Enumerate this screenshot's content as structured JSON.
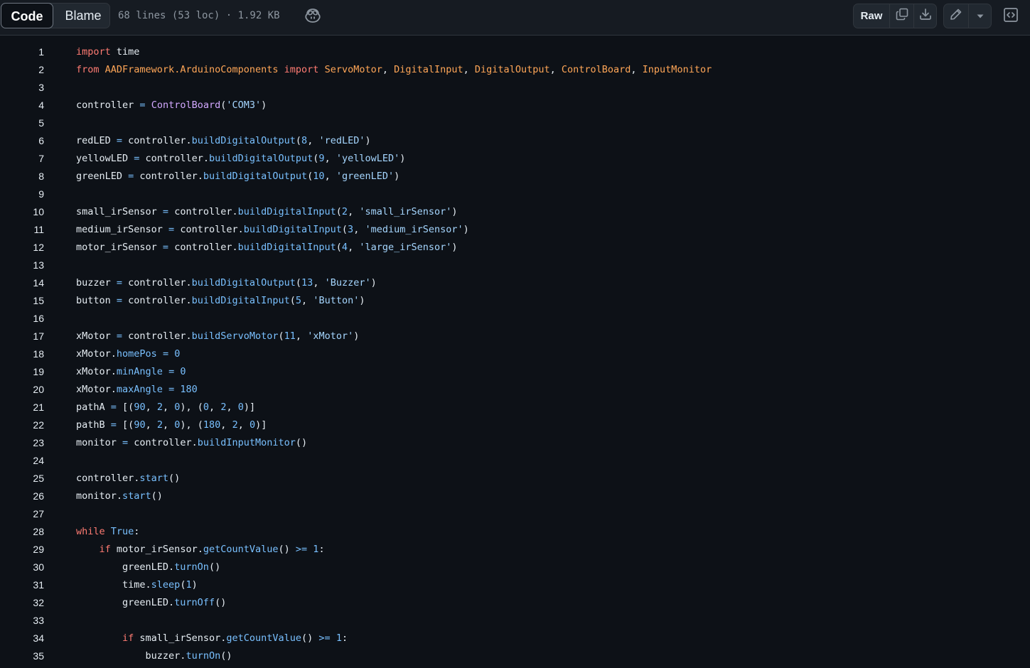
{
  "toolbar": {
    "tabs": [
      {
        "label": "Code",
        "active": true
      },
      {
        "label": "Blame",
        "active": false
      }
    ],
    "file_info": "68 lines (53 loc) · 1.92 KB",
    "raw_label": "Raw",
    "icons": [
      "copilot-icon",
      "copy-icon",
      "download-icon",
      "pencil-icon",
      "triangle-down-icon",
      "code-square-icon"
    ]
  },
  "colors": {
    "keyword": "#ff7b72",
    "function": "#79c0ff",
    "class": "#d2a8ff",
    "string": "#a5d6ff",
    "module": "#ffa657",
    "background": "#0d1117"
  },
  "code": {
    "lines": [
      [
        [
          "k",
          "import"
        ],
        [
          "pl",
          " time"
        ]
      ],
      [
        [
          "k",
          "from"
        ],
        [
          "pl",
          " "
        ],
        [
          "mod",
          "AADFramework.ArduinoComponents"
        ],
        [
          "pl",
          " "
        ],
        [
          "k",
          "import"
        ],
        [
          "pl",
          " "
        ],
        [
          "mod",
          "ServoMotor"
        ],
        [
          "pl",
          ", "
        ],
        [
          "mod",
          "DigitalInput"
        ],
        [
          "pl",
          ", "
        ],
        [
          "mod",
          "DigitalOutput"
        ],
        [
          "pl",
          ", "
        ],
        [
          "mod",
          "ControlBoard"
        ],
        [
          "pl",
          ", "
        ],
        [
          "mod",
          "InputMonitor"
        ]
      ],
      [],
      [
        [
          "pl",
          "controller "
        ],
        [
          "op",
          "="
        ],
        [
          "pl",
          " "
        ],
        [
          "cls",
          "ControlBoard"
        ],
        [
          "pl",
          "("
        ],
        [
          "str",
          "'COM3'"
        ],
        [
          "pl",
          ")"
        ]
      ],
      [],
      [
        [
          "pl",
          "redLED "
        ],
        [
          "op",
          "="
        ],
        [
          "pl",
          " controller."
        ],
        [
          "fn",
          "buildDigitalOutput"
        ],
        [
          "pl",
          "("
        ],
        [
          "num",
          "8"
        ],
        [
          "pl",
          ", "
        ],
        [
          "str",
          "'redLED'"
        ],
        [
          "pl",
          ")"
        ]
      ],
      [
        [
          "pl",
          "yellowLED "
        ],
        [
          "op",
          "="
        ],
        [
          "pl",
          " controller."
        ],
        [
          "fn",
          "buildDigitalOutput"
        ],
        [
          "pl",
          "("
        ],
        [
          "num",
          "9"
        ],
        [
          "pl",
          ", "
        ],
        [
          "str",
          "'yellowLED'"
        ],
        [
          "pl",
          ")"
        ]
      ],
      [
        [
          "pl",
          "greenLED "
        ],
        [
          "op",
          "="
        ],
        [
          "pl",
          " controller."
        ],
        [
          "fn",
          "buildDigitalOutput"
        ],
        [
          "pl",
          "("
        ],
        [
          "num",
          "10"
        ],
        [
          "pl",
          ", "
        ],
        [
          "str",
          "'greenLED'"
        ],
        [
          "pl",
          ")"
        ]
      ],
      [],
      [
        [
          "pl",
          "small_irSensor "
        ],
        [
          "op",
          "="
        ],
        [
          "pl",
          " controller."
        ],
        [
          "fn",
          "buildDigitalInput"
        ],
        [
          "pl",
          "("
        ],
        [
          "num",
          "2"
        ],
        [
          "pl",
          ", "
        ],
        [
          "str",
          "'small_irSensor'"
        ],
        [
          "pl",
          ")"
        ]
      ],
      [
        [
          "pl",
          "medium_irSensor "
        ],
        [
          "op",
          "="
        ],
        [
          "pl",
          " controller."
        ],
        [
          "fn",
          "buildDigitalInput"
        ],
        [
          "pl",
          "("
        ],
        [
          "num",
          "3"
        ],
        [
          "pl",
          ", "
        ],
        [
          "str",
          "'medium_irSensor'"
        ],
        [
          "pl",
          ")"
        ]
      ],
      [
        [
          "pl",
          "motor_irSensor "
        ],
        [
          "op",
          "="
        ],
        [
          "pl",
          " controller."
        ],
        [
          "fn",
          "buildDigitalInput"
        ],
        [
          "pl",
          "("
        ],
        [
          "num",
          "4"
        ],
        [
          "pl",
          ", "
        ],
        [
          "str",
          "'large_irSensor'"
        ],
        [
          "pl",
          ")"
        ]
      ],
      [],
      [
        [
          "pl",
          "buzzer "
        ],
        [
          "op",
          "="
        ],
        [
          "pl",
          " controller."
        ],
        [
          "fn",
          "buildDigitalOutput"
        ],
        [
          "pl",
          "("
        ],
        [
          "num",
          "13"
        ],
        [
          "pl",
          ", "
        ],
        [
          "str",
          "'Buzzer'"
        ],
        [
          "pl",
          ")"
        ]
      ],
      [
        [
          "pl",
          "button "
        ],
        [
          "op",
          "="
        ],
        [
          "pl",
          " controller."
        ],
        [
          "fn",
          "buildDigitalInput"
        ],
        [
          "pl",
          "("
        ],
        [
          "num",
          "5"
        ],
        [
          "pl",
          ", "
        ],
        [
          "str",
          "'Button'"
        ],
        [
          "pl",
          ")"
        ]
      ],
      [],
      [
        [
          "pl",
          "xMotor "
        ],
        [
          "op",
          "="
        ],
        [
          "pl",
          " controller."
        ],
        [
          "fn",
          "buildServoMotor"
        ],
        [
          "pl",
          "("
        ],
        [
          "num",
          "11"
        ],
        [
          "pl",
          ", "
        ],
        [
          "str",
          "'xMotor'"
        ],
        [
          "pl",
          ")"
        ]
      ],
      [
        [
          "pl",
          "xMotor."
        ],
        [
          "fn",
          "homePos"
        ],
        [
          "pl",
          " "
        ],
        [
          "op",
          "="
        ],
        [
          "pl",
          " "
        ],
        [
          "num",
          "0"
        ]
      ],
      [
        [
          "pl",
          "xMotor."
        ],
        [
          "fn",
          "minAngle"
        ],
        [
          "pl",
          " "
        ],
        [
          "op",
          "="
        ],
        [
          "pl",
          " "
        ],
        [
          "num",
          "0"
        ]
      ],
      [
        [
          "pl",
          "xMotor."
        ],
        [
          "fn",
          "maxAngle"
        ],
        [
          "pl",
          " "
        ],
        [
          "op",
          "="
        ],
        [
          "pl",
          " "
        ],
        [
          "num",
          "180"
        ]
      ],
      [
        [
          "pl",
          "pathA "
        ],
        [
          "op",
          "="
        ],
        [
          "pl",
          " [("
        ],
        [
          "num",
          "90"
        ],
        [
          "pl",
          ", "
        ],
        [
          "num",
          "2"
        ],
        [
          "pl",
          ", "
        ],
        [
          "num",
          "0"
        ],
        [
          "pl",
          "), ("
        ],
        [
          "num",
          "0"
        ],
        [
          "pl",
          ", "
        ],
        [
          "num",
          "2"
        ],
        [
          "pl",
          ", "
        ],
        [
          "num",
          "0"
        ],
        [
          "pl",
          ")]"
        ]
      ],
      [
        [
          "pl",
          "pathB "
        ],
        [
          "op",
          "="
        ],
        [
          "pl",
          " [("
        ],
        [
          "num",
          "90"
        ],
        [
          "pl",
          ", "
        ],
        [
          "num",
          "2"
        ],
        [
          "pl",
          ", "
        ],
        [
          "num",
          "0"
        ],
        [
          "pl",
          "), ("
        ],
        [
          "num",
          "180"
        ],
        [
          "pl",
          ", "
        ],
        [
          "num",
          "2"
        ],
        [
          "pl",
          ", "
        ],
        [
          "num",
          "0"
        ],
        [
          "pl",
          ")]"
        ]
      ],
      [
        [
          "pl",
          "monitor "
        ],
        [
          "op",
          "="
        ],
        [
          "pl",
          " controller."
        ],
        [
          "fn",
          "buildInputMonitor"
        ],
        [
          "pl",
          "()"
        ]
      ],
      [],
      [
        [
          "pl",
          "controller."
        ],
        [
          "fn",
          "start"
        ],
        [
          "pl",
          "()"
        ]
      ],
      [
        [
          "pl",
          "monitor."
        ],
        [
          "fn",
          "start"
        ],
        [
          "pl",
          "()"
        ]
      ],
      [],
      [
        [
          "k",
          "while"
        ],
        [
          "pl",
          " "
        ],
        [
          "num",
          "True"
        ],
        [
          "pl",
          ":"
        ]
      ],
      [
        [
          "pl",
          "    "
        ],
        [
          "k",
          "if"
        ],
        [
          "pl",
          " motor_irSensor."
        ],
        [
          "fn",
          "getCountValue"
        ],
        [
          "pl",
          "() "
        ],
        [
          "op",
          ">="
        ],
        [
          "pl",
          " "
        ],
        [
          "num",
          "1"
        ],
        [
          "pl",
          ":"
        ]
      ],
      [
        [
          "pl",
          "        greenLED."
        ],
        [
          "fn",
          "turnOn"
        ],
        [
          "pl",
          "()"
        ]
      ],
      [
        [
          "pl",
          "        time."
        ],
        [
          "fn",
          "sleep"
        ],
        [
          "pl",
          "("
        ],
        [
          "num",
          "1"
        ],
        [
          "pl",
          ")"
        ]
      ],
      [
        [
          "pl",
          "        greenLED."
        ],
        [
          "fn",
          "turnOff"
        ],
        [
          "pl",
          "()"
        ]
      ],
      [],
      [
        [
          "pl",
          "        "
        ],
        [
          "k",
          "if"
        ],
        [
          "pl",
          " small_irSensor."
        ],
        [
          "fn",
          "getCountValue"
        ],
        [
          "pl",
          "() "
        ],
        [
          "op",
          ">="
        ],
        [
          "pl",
          " "
        ],
        [
          "num",
          "1"
        ],
        [
          "pl",
          ":"
        ]
      ],
      [
        [
          "pl",
          "            buzzer."
        ],
        [
          "fn",
          "turnOn"
        ],
        [
          "pl",
          "()"
        ]
      ]
    ]
  }
}
